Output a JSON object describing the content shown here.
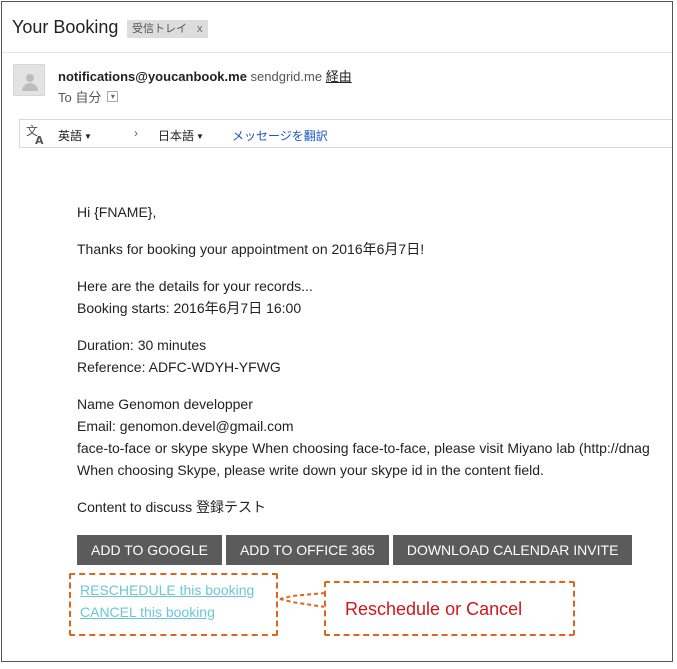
{
  "header": {
    "title": "Your Booking",
    "label": "受信トレイ",
    "label_close": "x"
  },
  "message": {
    "sender_email": "notifications@youcanbook.me",
    "sender_via_domain": "sendgrid.me",
    "sender_via_word": "経由",
    "to_text": "To 自分"
  },
  "translate": {
    "source_lang": "英語",
    "target_lang": "日本語",
    "translate_link": "メッセージを翻訳",
    "arrow": "›"
  },
  "body": {
    "greeting": "Hi {FNAME},",
    "thanks": "Thanks for booking your appointment on 2016年6月7日!",
    "details_intro": "Here are the details for your records...",
    "booking_starts": "Booking starts: 2016年6月7日 16:00",
    "duration": "Duration: 30 minutes",
    "reference": "Reference: ADFC-WDYH-YFWG",
    "name": "Name Genomon developper",
    "email": "Email: genomon.devel@gmail.com",
    "face_to_face": "face-to-face or skype skype When choosing face-to-face, please visit Miyano lab (http://dnag",
    "skype_note": "When choosing Skype, please write down your skype id in the content field.",
    "content": "Content to discuss 登録テスト"
  },
  "buttons": {
    "add_google": "ADD TO GOOGLE",
    "add_office": "ADD TO OFFICE 365",
    "download_invite": "DOWNLOAD CALENDAR INVITE"
  },
  "links": {
    "reschedule": "RESCHEDULE this booking",
    "cancel": "CANCEL this booking"
  },
  "annotation": {
    "callout_text": "Reschedule or Cancel"
  },
  "colors": {
    "button_bg": "#5b5b5b",
    "link": "#6cc6d8",
    "annotation_border": "#e0651a",
    "annotation_text": "#d0171b",
    "translate_link": "#1a57c4"
  }
}
